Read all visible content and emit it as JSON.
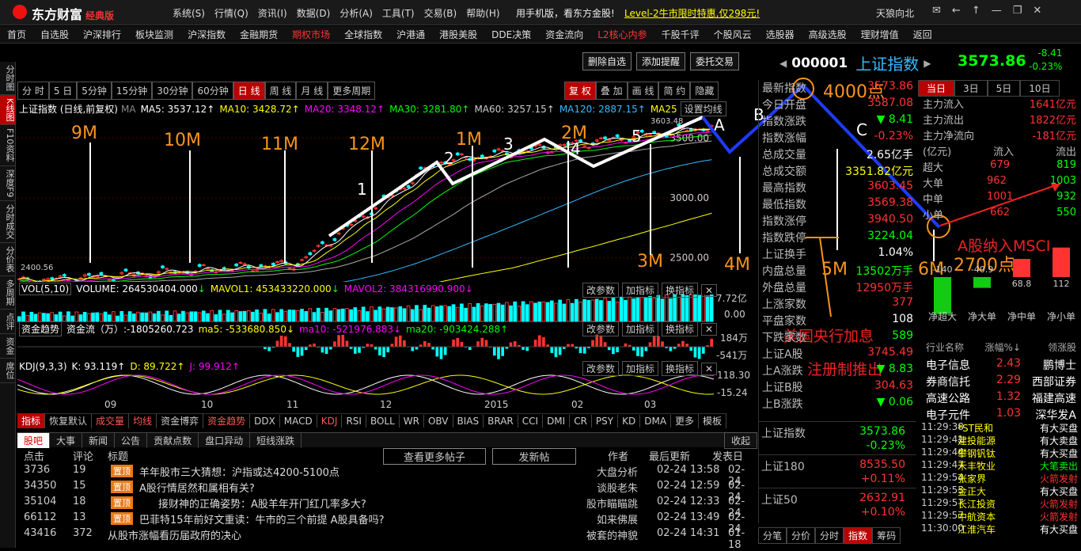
{
  "app": {
    "name": "东方财富",
    "edition": "经典版",
    "menus": [
      "系统(S)",
      "行情(Q)",
      "资讯(I)",
      "数据(D)",
      "分析(A)",
      "工具(T)",
      "交易(B)",
      "帮助(H)"
    ],
    "promo1": "用手机版，看东方金股!",
    "promo2": "Level-2牛市限时特惠,仅298元!",
    "user": "天狼向北"
  },
  "nav": [
    "首页",
    "自选股",
    "沪深排行",
    "板块监测",
    "沪深指数",
    "金融期货",
    "期权市场",
    "全球指数",
    "沪港通",
    "港股美股",
    "DDE决策",
    "资金流向",
    "L2核心内参",
    "千股千评",
    "个股风云",
    "选股器",
    "高级选股",
    "理财增值",
    "返回"
  ],
  "left_tabs": [
    "分时图",
    "K线图",
    "F10资料",
    "深度F9",
    "分时成交",
    "分价表",
    "多周期",
    "点评",
    "资金",
    "席位"
  ],
  "tool_buttons": [
    "删除自选",
    "添加提醒",
    "委托交易"
  ],
  "stock": {
    "code": "000001",
    "name": "上证指数",
    "price": "3573.86",
    "change": "-8.41",
    "pct": "-0.23%"
  },
  "periods": [
    "分 时",
    "5 日",
    "5分钟",
    "15分钟",
    "30分钟",
    "60分钟",
    "日 线",
    "周 线",
    "月 线",
    "更多周期"
  ],
  "right_tools": [
    "复 权",
    "叠 加",
    "画 线",
    "简 约",
    "隐藏"
  ],
  "ma_legend": {
    "name": "上证指数 (日线,前复权)",
    "ma": "MA",
    "ma5": "MA5: 3537.12",
    "ma10": "MA10: 3428.72",
    "ma20": "MA20: 3348.12",
    "ma30": "MA30: 3281.80",
    "ma60": "MA60: 3257.15",
    "ma120": "MA120: 2887.15",
    "ma250": "MA25",
    "set": "设置均线"
  },
  "price_axis": [
    "3500.00",
    "3000.00",
    "2500.00"
  ],
  "chart_labels": {
    "low": "2400.56",
    "high": "3603.48"
  },
  "vol": {
    "label": "VOL(5,10)",
    "volume": "VOLUME: 264530404.000",
    "mavol1": "MAVOL1: 453433220.000",
    "mavol2": "MAVOL2: 384316990.900",
    "axis": [
      "7.72亿",
      "0.00"
    ]
  },
  "flow": {
    "label": "资金趋势",
    "line": "资金流（万）:-1805260.723",
    "ma5": "ma5: -533680.850",
    "ma10": "ma10: -521976.883",
    "ma20": "ma20: -903424.288",
    "axis": [
      "184万",
      "-541万"
    ]
  },
  "kdj": {
    "label": "KDJ(9,3,3)",
    "k": "K: 93.119",
    "d": "D: 89.722",
    "j": "J: 99.912",
    "axis": [
      "118.30",
      "-15.24"
    ]
  },
  "sub_buttons": [
    "改参数",
    "加指标",
    "换指标"
  ],
  "time_axis": [
    "09",
    "10",
    "11",
    "12",
    "2015",
    "02",
    "03"
  ],
  "indicator_tabs": [
    "指标",
    "恢复默认",
    "成交量",
    "均线",
    "资金博弈",
    "资金趋势",
    "DDX",
    "MACD",
    "KDJ",
    "RSI",
    "BOLL",
    "WR",
    "OBV",
    "BIAS",
    "BRAR",
    "CCI",
    "DMI",
    "CR",
    "PSY",
    "KD",
    "DMA",
    "更多",
    "模板"
  ],
  "annotations": {
    "months": [
      "9M",
      "10M",
      "11M",
      "12M",
      "1M",
      "2M",
      "3M",
      "4M",
      "5M",
      "6M"
    ],
    "waves": [
      "1",
      "2",
      "3",
      "4",
      "5"
    ],
    "abc": [
      "A",
      "B",
      "C"
    ],
    "target_top": "4000点",
    "target_low": "2700点",
    "msci": "A股纳入MSCI",
    "fed": "美国央行加息",
    "reg": "注册制推出"
  },
  "bottom": {
    "tabs": [
      "股吧",
      "大事",
      "新闻",
      "公告",
      "贡献点数",
      "盘口异动",
      "短线涨跌"
    ],
    "collapse": "收起",
    "cols": [
      "点击",
      "评论",
      "标题",
      "作者",
      "最后更新",
      "发表日"
    ],
    "more": "查看更多帖子",
    "post": "发新帖",
    "posts": [
      {
        "clicks": "3736",
        "comments": "19",
        "top": true,
        "title": "羊年股市三大猜想：沪指或达4200-5100点",
        "author": "大盘分析",
        "updated": "02-24 13:58",
        "date": "02-24"
      },
      {
        "clicks": "34350",
        "comments": "15",
        "top": true,
        "title": "A股行情居然和属相有关?",
        "author": "谈股老朱",
        "updated": "02-24 12:59",
        "date": "02-24"
      },
      {
        "clicks": "35104",
        "comments": "18",
        "top": true,
        "title": "接财神的正确姿势：A股羊年开门红几率多大?",
        "author": "股市瞄瞄跳",
        "updated": "02-24 12:33",
        "date": "02-24"
      },
      {
        "clicks": "66112",
        "comments": "13",
        "top": true,
        "title": "巴菲特15年前好文重读：牛市的三个前提 A股具备吗?",
        "author": "如来佛展",
        "updated": "02-24 13:49",
        "date": "02-24"
      },
      {
        "clicks": "43416",
        "comments": "372",
        "top": false,
        "title": "从股市涨幅看历届政府的决心",
        "author": "被套的神貌",
        "updated": "02-24 14:31",
        "date": "01-18"
      }
    ]
  },
  "quote": [
    {
      "k": "最新指数",
      "v": "3573.86",
      "c": "r"
    },
    {
      "k": "今日开盘",
      "v": "3587.08",
      "c": "r"
    },
    {
      "k": "指数涨跌",
      "v": "▼ 8.41",
      "c": "g"
    },
    {
      "k": "指数涨幅",
      "v": "-0.23%",
      "c": "r"
    },
    {
      "k": "总成交量",
      "v": "2.65亿手",
      "c": "w"
    },
    {
      "k": "总成交额",
      "v": "3351.82亿元",
      "c": "y"
    },
    {
      "k": "最高指数",
      "v": "3603.45",
      "c": "r"
    },
    {
      "k": "最低指数",
      "v": "3569.38",
      "c": "r"
    },
    {
      "k": "指数涨停",
      "v": "3940.50",
      "c": "r"
    },
    {
      "k": "指数跌停",
      "v": "3224.04",
      "c": "g"
    },
    {
      "k": "上证换手",
      "v": "1.04%",
      "c": "w"
    },
    {
      "k": "内盘总量",
      "v": "13502万手",
      "c": "g"
    },
    {
      "k": "外盘总量",
      "v": "12950万手",
      "c": "r"
    },
    {
      "k": "上涨家数",
      "v": "377",
      "c": "r"
    },
    {
      "k": "平盘家数",
      "v": "108",
      "c": "w"
    },
    {
      "k": "下跌家数",
      "v": "589",
      "c": "g"
    },
    {
      "k": "上证A股",
      "v": "3745.49",
      "c": "r"
    },
    {
      "k": "上A涨跌",
      "v": "▼ 8.83",
      "c": "g"
    },
    {
      "k": "上证B股",
      "v": "304.63",
      "c": "r"
    },
    {
      "k": "上B涨跌",
      "v": "▼ 0.06",
      "c": "g"
    }
  ],
  "idx2": [
    {
      "k": "上证指数",
      "v": "3573.86",
      "p": "-0.23%",
      "c": "g"
    },
    {
      "k": "上证180",
      "v": "8535.50",
      "p": "+0.11%",
      "c": "r"
    },
    {
      "k": "上证50",
      "v": "2632.91",
      "p": "+0.10%",
      "c": "r"
    }
  ],
  "rtabs": [
    "分笔",
    "分价",
    "分时",
    "指数",
    "筹码"
  ],
  "flowpanel": {
    "tabs": [
      "当日",
      "3日",
      "5日",
      "10日"
    ],
    "main": [
      {
        "k": "主力流入",
        "v": "1641亿元"
      },
      {
        "k": "主力流出",
        "v": "1822亿元"
      },
      {
        "k": "主力净流向",
        "v": "-181亿元"
      }
    ],
    "head": [
      "(亿元)",
      "流入",
      "流出"
    ],
    "rows": [
      {
        "k": "超大",
        "in": "679",
        "out": "819"
      },
      {
        "k": "大单",
        "in": "962",
        "out": "1003"
      },
      {
        "k": "中单",
        "in": "1001",
        "out": "932"
      },
      {
        "k": "小单",
        "in": "662",
        "out": "550"
      }
    ],
    "bars": [
      {
        "label": "净超大",
        "value": "-140"
      },
      {
        "label": "净大单",
        "value": "-40.9"
      },
      {
        "label": "净中单",
        "value": "68.8"
      },
      {
        "label": "净小单",
        "value": "112"
      }
    ]
  },
  "industry": {
    "head": [
      "行业名称",
      "涨幅%↓",
      "领涨股"
    ],
    "rows": [
      {
        "n": "电子信息",
        "p": "2.43",
        "s": "鹏博士"
      },
      {
        "n": "券商信托",
        "p": "2.29",
        "s": "西部证券"
      },
      {
        "n": "高速公路",
        "p": "1.32",
        "s": "福建高速"
      },
      {
        "n": "电子元件",
        "p": "1.03",
        "s": "深华发A"
      }
    ]
  },
  "ticks": [
    {
      "t": "11:29:38",
      "n": "*ST民和",
      "a": "有大买盘",
      "c": "w"
    },
    {
      "t": "11:29:41",
      "n": "建投能源",
      "a": "有大卖盘",
      "c": "w"
    },
    {
      "t": "11:29:44",
      "n": "攀钢钒钛",
      "a": "有大买盘",
      "c": "w"
    },
    {
      "t": "11:29:47",
      "n": "禾丰牧业",
      "a": "大笔卖出",
      "c": "g"
    },
    {
      "t": "11:29:54",
      "n": "张家界",
      "a": "火箭发射",
      "c": "r"
    },
    {
      "t": "11:29:55",
      "n": "金正大",
      "a": "有大买盘",
      "c": "w"
    },
    {
      "t": "11:29:57",
      "n": "长江投资",
      "a": "火箭发射",
      "c": "r"
    },
    {
      "t": "11:29:57",
      "n": "中航资本",
      "a": "火箭发射",
      "c": "r"
    },
    {
      "t": "11:30:00",
      "n": "江淮汽车",
      "a": "有大买盘",
      "c": "w"
    }
  ],
  "colors": {
    "red": "#ff3333",
    "green": "#00ff00",
    "accent": "#b00000",
    "annotation": "#f7941d",
    "wave": "#ffffff",
    "forecast": "#1f3bff"
  }
}
